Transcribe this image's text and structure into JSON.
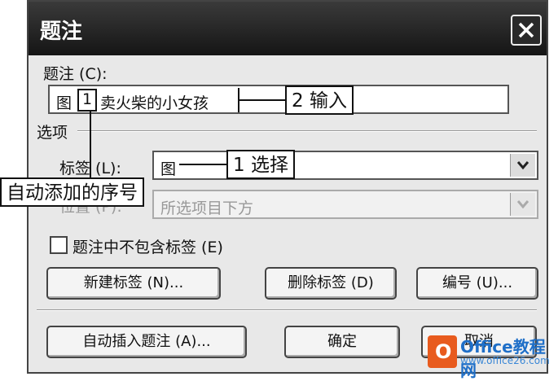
{
  "dialog": {
    "title": "题注",
    "caption_label": "题注 (C):",
    "caption_prefix": "图",
    "caption_number": "1",
    "caption_text": "卖火柴的小女孩",
    "options_label": "选项",
    "label_label": "标签 (L):",
    "label_value": "图",
    "position_label": "位置 (P):",
    "position_value": "所选项目下方",
    "exclude_label": "题注中不包含标签 (E)",
    "new_label_button": "新建标签 (N)...",
    "delete_label_button": "删除标签 (D)",
    "numbering_button": "编号 (U)...",
    "autocaption_button": "自动插入题注 (A)...",
    "ok_button": "确定",
    "cancel_button": "取消"
  },
  "callouts": {
    "input": "2 输入",
    "select": "1 选择",
    "auto_number": "自动添加的序号"
  },
  "watermark": {
    "line1": "Office教程网",
    "line2": "www.office26.com",
    "logo_glyph": "O",
    "brand_color": "#e85b1e"
  }
}
